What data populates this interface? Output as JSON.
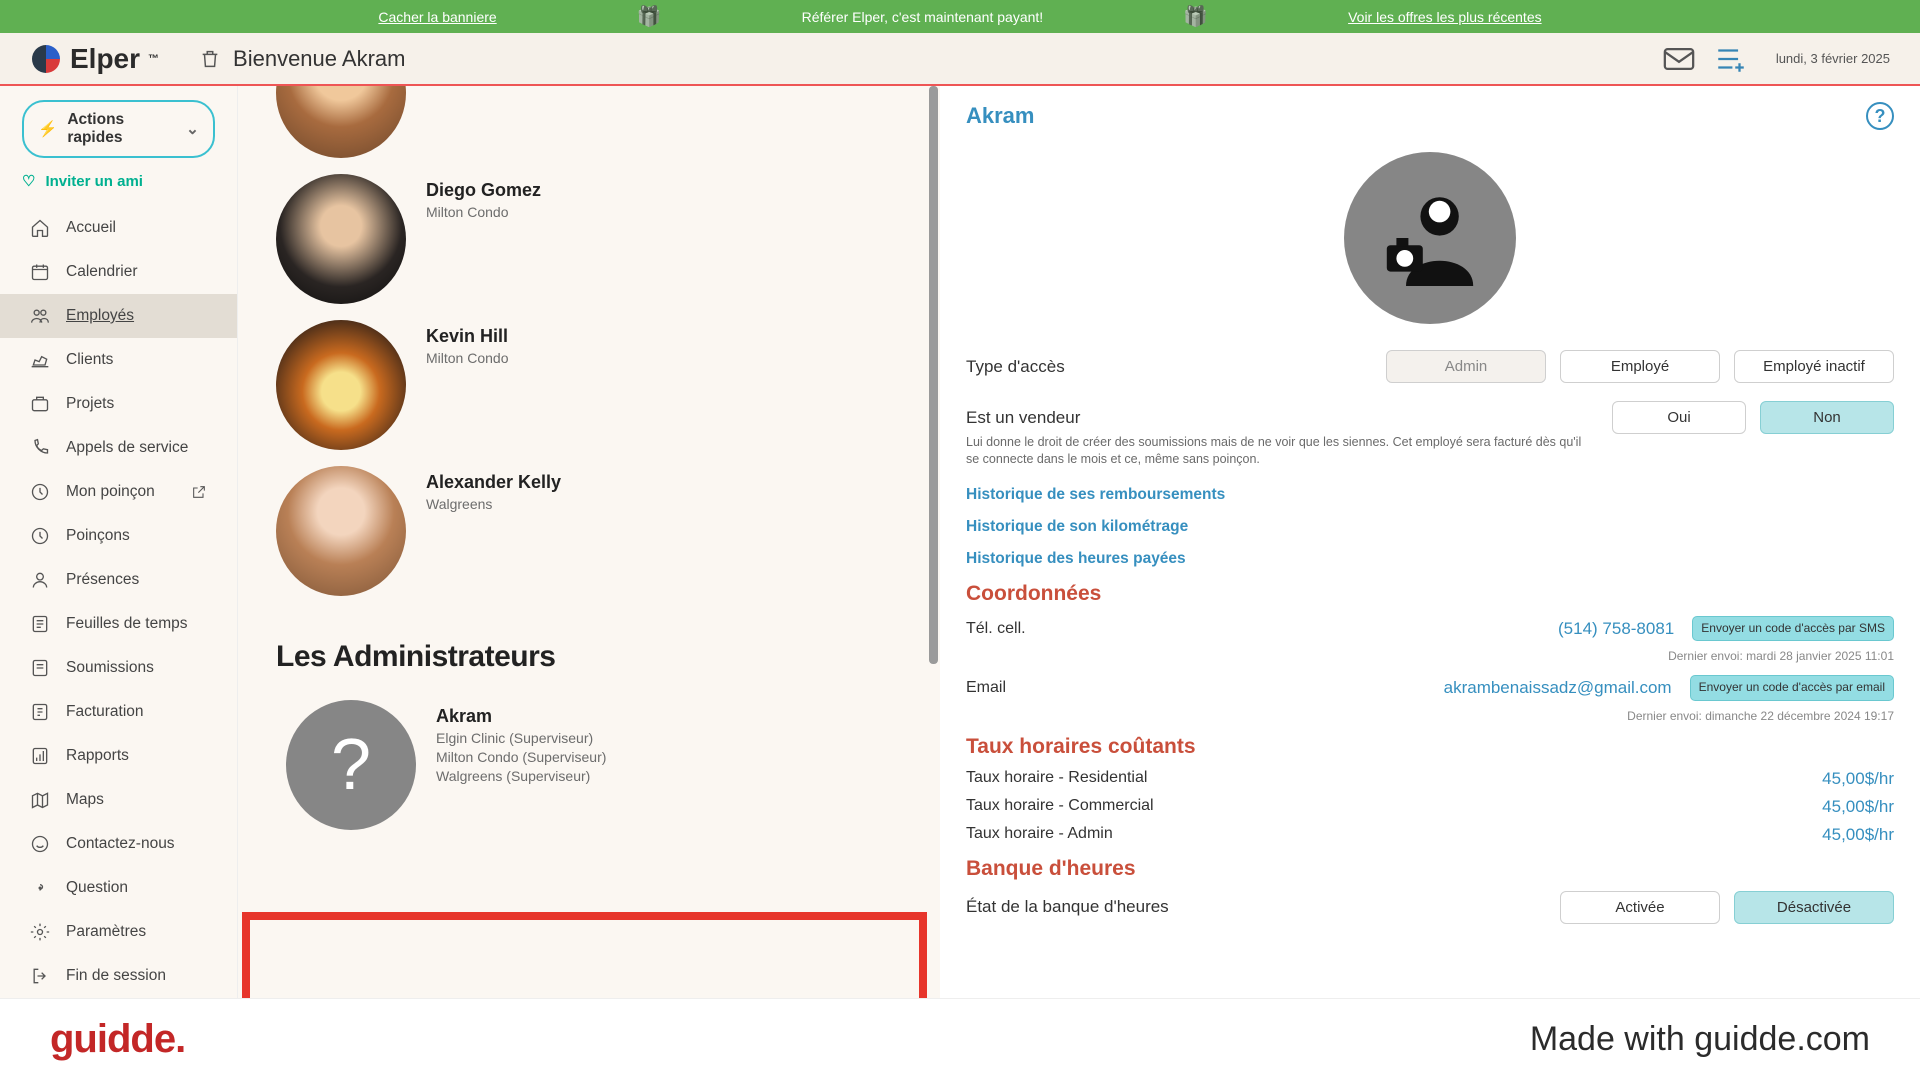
{
  "banner": {
    "hide": "Cacher la banniere",
    "center": "Référer Elper, c'est maintenant payant!",
    "offers": "Voir les offres les plus récentes"
  },
  "topbar": {
    "brand": "Elper",
    "welcome": "Bienvenue Akram",
    "date": "lundi, 3 février 2025"
  },
  "quick_actions": {
    "label": "Actions rapides"
  },
  "invite": {
    "label": "Inviter un ami"
  },
  "nav": [
    {
      "label": "Accueil",
      "name": "home"
    },
    {
      "label": "Calendrier",
      "name": "calendar"
    },
    {
      "label": "Employés",
      "name": "employees",
      "active": true
    },
    {
      "label": "Clients",
      "name": "clients"
    },
    {
      "label": "Projets",
      "name": "projects"
    },
    {
      "label": "Appels de service",
      "name": "service-calls"
    },
    {
      "label": "Mon poinçon",
      "name": "my-punch",
      "ext": true
    },
    {
      "label": "Poinçons",
      "name": "punches"
    },
    {
      "label": "Présences",
      "name": "presences"
    },
    {
      "label": "Feuilles de temps",
      "name": "timesheets"
    },
    {
      "label": "Soumissions",
      "name": "quotes"
    },
    {
      "label": "Facturation",
      "name": "billing"
    },
    {
      "label": "Rapports",
      "name": "reports"
    },
    {
      "label": "Maps",
      "name": "maps"
    },
    {
      "label": "Contactez-nous",
      "name": "contact"
    },
    {
      "label": "Question",
      "name": "question"
    },
    {
      "label": "Paramètres",
      "name": "settings"
    },
    {
      "label": "Fin de session",
      "name": "logout"
    }
  ],
  "employees": [
    {
      "name": "Diego Gomez",
      "sub": "Milton Condo"
    },
    {
      "name": "Kevin Hill",
      "sub": "Milton Condo"
    },
    {
      "name": "Alexander Kelly",
      "sub": "Walgreens"
    }
  ],
  "admins": {
    "title": "Les Administrateurs",
    "entry": {
      "name": "Akram",
      "lines": [
        "Elgin Clinic (Superviseur)",
        "Milton Condo (Superviseur)",
        "Walgreens (Superviseur)"
      ]
    }
  },
  "detail": {
    "name": "Akram",
    "access_label": "Type d'accès",
    "access_opts": [
      "Admin",
      "Employé",
      "Employé inactif"
    ],
    "seller_label": "Est un vendeur",
    "oui": "Oui",
    "non": "Non",
    "seller_note": "Lui donne le droit de créer des soumissions mais de ne voir que les siennes. Cet employé sera facturé dès qu'il se connecte dans le mois et ce, même sans poinçon.",
    "history": [
      "Historique de ses remboursements",
      "Historique de son kilométrage",
      "Historique des heures payées"
    ],
    "coords_h": "Coordonnées",
    "tel_label": "Tél. cell.",
    "tel_val": "(514) 758-8081",
    "tel_btn": "Envoyer un code d'accès par SMS",
    "tel_note": "Dernier envoi: mardi 28 janvier 2025 11:01",
    "email_label": "Email",
    "email_val": "akrambenaissadz@gmail.com",
    "email_btn": "Envoyer un code d'accès par email",
    "email_note": "Dernier envoi: dimanche 22 décembre 2024 19:17",
    "rates_h": "Taux horaires coûtants",
    "rates": [
      {
        "label": "Taux horaire  - Residential",
        "val": "45,00$/hr"
      },
      {
        "label": "Taux horaire  - Commercial",
        "val": "45,00$/hr"
      },
      {
        "label": "Taux horaire  - Admin",
        "val": "45,00$/hr"
      }
    ],
    "bank_h": "Banque d'heures",
    "bank_label": "État de la banque d'heures",
    "bank_on": "Activée",
    "bank_off": "Désactivée"
  },
  "footer": {
    "logo": "guidde.",
    "credit": "Made with guidde.com"
  }
}
